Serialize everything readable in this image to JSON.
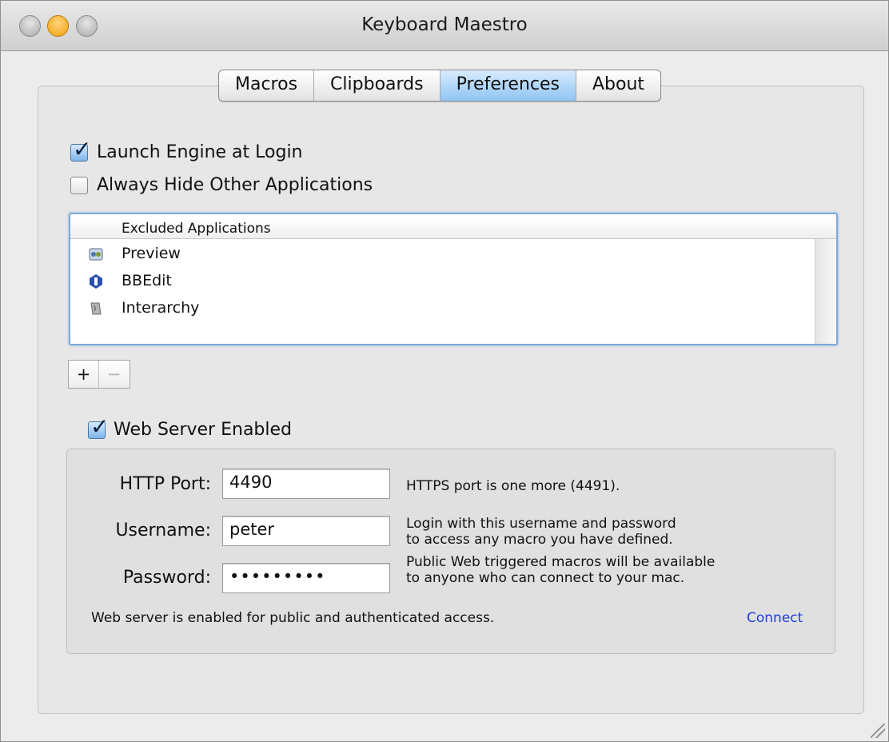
{
  "window": {
    "title": "Keyboard Maestro"
  },
  "tabs": [
    {
      "label": "Macros",
      "active": false
    },
    {
      "label": "Clipboards",
      "active": false
    },
    {
      "label": "Preferences",
      "active": true
    },
    {
      "label": "About",
      "active": false
    }
  ],
  "options": {
    "launch_engine": {
      "label": "Launch Engine at Login",
      "checked": true
    },
    "hide_apps": {
      "label": "Always Hide Other Applications",
      "checked": false
    }
  },
  "excluded_apps": {
    "header": "Excluded Applications",
    "items": [
      {
        "name": "Preview",
        "icon": "preview-icon"
      },
      {
        "name": "BBEdit",
        "icon": "bbedit-icon"
      },
      {
        "name": "Interarchy",
        "icon": "interarchy-icon"
      }
    ]
  },
  "list_buttons": {
    "add": "+",
    "remove": "−"
  },
  "web_server": {
    "enabled_label": "Web Server Enabled",
    "enabled": true,
    "http_port_label": "HTTP Port:",
    "http_port": "4490",
    "https_info": "HTTPS port is one more (4491).",
    "username_label": "Username:",
    "username": "peter",
    "password_label": "Password:",
    "password": "•••••••••",
    "login_info_1": "Login with this username and password",
    "login_info_2": "to access any macro you have defined.",
    "public_info_1": "Public Web triggered macros will be available",
    "public_info_2": "to anyone who can connect to your mac.",
    "status": "Web server is enabled for public and authenticated access.",
    "connect_label": "Connect"
  },
  "colors": {
    "accent": "#8fc4f2",
    "link": "#1e3fd6"
  }
}
